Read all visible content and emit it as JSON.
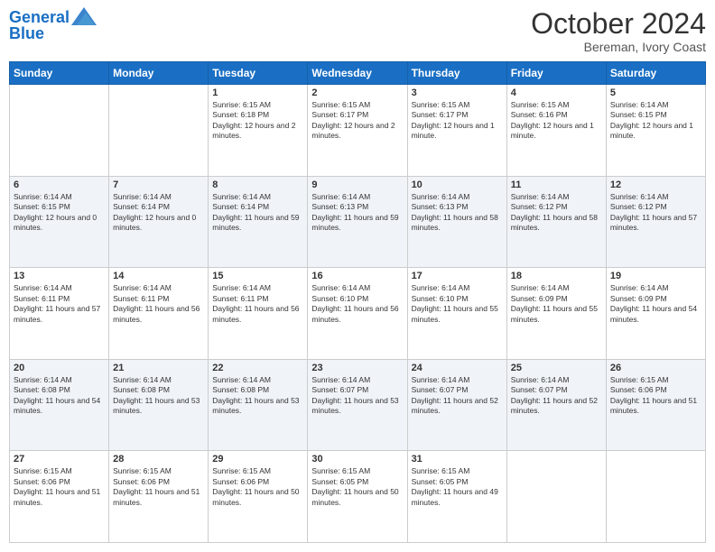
{
  "header": {
    "logo_line1": "General",
    "logo_line2": "Blue",
    "month_title": "October 2024",
    "location": "Bereman, Ivory Coast"
  },
  "days_of_week": [
    "Sunday",
    "Monday",
    "Tuesday",
    "Wednesday",
    "Thursday",
    "Friday",
    "Saturday"
  ],
  "weeks": [
    [
      {
        "day": "",
        "sunrise": "",
        "sunset": "",
        "daylight": ""
      },
      {
        "day": "",
        "sunrise": "",
        "sunset": "",
        "daylight": ""
      },
      {
        "day": "1",
        "sunrise": "Sunrise: 6:15 AM",
        "sunset": "Sunset: 6:18 PM",
        "daylight": "Daylight: 12 hours and 2 minutes."
      },
      {
        "day": "2",
        "sunrise": "Sunrise: 6:15 AM",
        "sunset": "Sunset: 6:17 PM",
        "daylight": "Daylight: 12 hours and 2 minutes."
      },
      {
        "day": "3",
        "sunrise": "Sunrise: 6:15 AM",
        "sunset": "Sunset: 6:17 PM",
        "daylight": "Daylight: 12 hours and 1 minute."
      },
      {
        "day": "4",
        "sunrise": "Sunrise: 6:15 AM",
        "sunset": "Sunset: 6:16 PM",
        "daylight": "Daylight: 12 hours and 1 minute."
      },
      {
        "day": "5",
        "sunrise": "Sunrise: 6:14 AM",
        "sunset": "Sunset: 6:15 PM",
        "daylight": "Daylight: 12 hours and 1 minute."
      }
    ],
    [
      {
        "day": "6",
        "sunrise": "Sunrise: 6:14 AM",
        "sunset": "Sunset: 6:15 PM",
        "daylight": "Daylight: 12 hours and 0 minutes."
      },
      {
        "day": "7",
        "sunrise": "Sunrise: 6:14 AM",
        "sunset": "Sunset: 6:14 PM",
        "daylight": "Daylight: 12 hours and 0 minutes."
      },
      {
        "day": "8",
        "sunrise": "Sunrise: 6:14 AM",
        "sunset": "Sunset: 6:14 PM",
        "daylight": "Daylight: 11 hours and 59 minutes."
      },
      {
        "day": "9",
        "sunrise": "Sunrise: 6:14 AM",
        "sunset": "Sunset: 6:13 PM",
        "daylight": "Daylight: 11 hours and 59 minutes."
      },
      {
        "day": "10",
        "sunrise": "Sunrise: 6:14 AM",
        "sunset": "Sunset: 6:13 PM",
        "daylight": "Daylight: 11 hours and 58 minutes."
      },
      {
        "day": "11",
        "sunrise": "Sunrise: 6:14 AM",
        "sunset": "Sunset: 6:12 PM",
        "daylight": "Daylight: 11 hours and 58 minutes."
      },
      {
        "day": "12",
        "sunrise": "Sunrise: 6:14 AM",
        "sunset": "Sunset: 6:12 PM",
        "daylight": "Daylight: 11 hours and 57 minutes."
      }
    ],
    [
      {
        "day": "13",
        "sunrise": "Sunrise: 6:14 AM",
        "sunset": "Sunset: 6:11 PM",
        "daylight": "Daylight: 11 hours and 57 minutes."
      },
      {
        "day": "14",
        "sunrise": "Sunrise: 6:14 AM",
        "sunset": "Sunset: 6:11 PM",
        "daylight": "Daylight: 11 hours and 56 minutes."
      },
      {
        "day": "15",
        "sunrise": "Sunrise: 6:14 AM",
        "sunset": "Sunset: 6:11 PM",
        "daylight": "Daylight: 11 hours and 56 minutes."
      },
      {
        "day": "16",
        "sunrise": "Sunrise: 6:14 AM",
        "sunset": "Sunset: 6:10 PM",
        "daylight": "Daylight: 11 hours and 56 minutes."
      },
      {
        "day": "17",
        "sunrise": "Sunrise: 6:14 AM",
        "sunset": "Sunset: 6:10 PM",
        "daylight": "Daylight: 11 hours and 55 minutes."
      },
      {
        "day": "18",
        "sunrise": "Sunrise: 6:14 AM",
        "sunset": "Sunset: 6:09 PM",
        "daylight": "Daylight: 11 hours and 55 minutes."
      },
      {
        "day": "19",
        "sunrise": "Sunrise: 6:14 AM",
        "sunset": "Sunset: 6:09 PM",
        "daylight": "Daylight: 11 hours and 54 minutes."
      }
    ],
    [
      {
        "day": "20",
        "sunrise": "Sunrise: 6:14 AM",
        "sunset": "Sunset: 6:08 PM",
        "daylight": "Daylight: 11 hours and 54 minutes."
      },
      {
        "day": "21",
        "sunrise": "Sunrise: 6:14 AM",
        "sunset": "Sunset: 6:08 PM",
        "daylight": "Daylight: 11 hours and 53 minutes."
      },
      {
        "day": "22",
        "sunrise": "Sunrise: 6:14 AM",
        "sunset": "Sunset: 6:08 PM",
        "daylight": "Daylight: 11 hours and 53 minutes."
      },
      {
        "day": "23",
        "sunrise": "Sunrise: 6:14 AM",
        "sunset": "Sunset: 6:07 PM",
        "daylight": "Daylight: 11 hours and 53 minutes."
      },
      {
        "day": "24",
        "sunrise": "Sunrise: 6:14 AM",
        "sunset": "Sunset: 6:07 PM",
        "daylight": "Daylight: 11 hours and 52 minutes."
      },
      {
        "day": "25",
        "sunrise": "Sunrise: 6:14 AM",
        "sunset": "Sunset: 6:07 PM",
        "daylight": "Daylight: 11 hours and 52 minutes."
      },
      {
        "day": "26",
        "sunrise": "Sunrise: 6:15 AM",
        "sunset": "Sunset: 6:06 PM",
        "daylight": "Daylight: 11 hours and 51 minutes."
      }
    ],
    [
      {
        "day": "27",
        "sunrise": "Sunrise: 6:15 AM",
        "sunset": "Sunset: 6:06 PM",
        "daylight": "Daylight: 11 hours and 51 minutes."
      },
      {
        "day": "28",
        "sunrise": "Sunrise: 6:15 AM",
        "sunset": "Sunset: 6:06 PM",
        "daylight": "Daylight: 11 hours and 51 minutes."
      },
      {
        "day": "29",
        "sunrise": "Sunrise: 6:15 AM",
        "sunset": "Sunset: 6:06 PM",
        "daylight": "Daylight: 11 hours and 50 minutes."
      },
      {
        "day": "30",
        "sunrise": "Sunrise: 6:15 AM",
        "sunset": "Sunset: 6:05 PM",
        "daylight": "Daylight: 11 hours and 50 minutes."
      },
      {
        "day": "31",
        "sunrise": "Sunrise: 6:15 AM",
        "sunset": "Sunset: 6:05 PM",
        "daylight": "Daylight: 11 hours and 49 minutes."
      },
      {
        "day": "",
        "sunrise": "",
        "sunset": "",
        "daylight": ""
      },
      {
        "day": "",
        "sunrise": "",
        "sunset": "",
        "daylight": ""
      }
    ]
  ]
}
